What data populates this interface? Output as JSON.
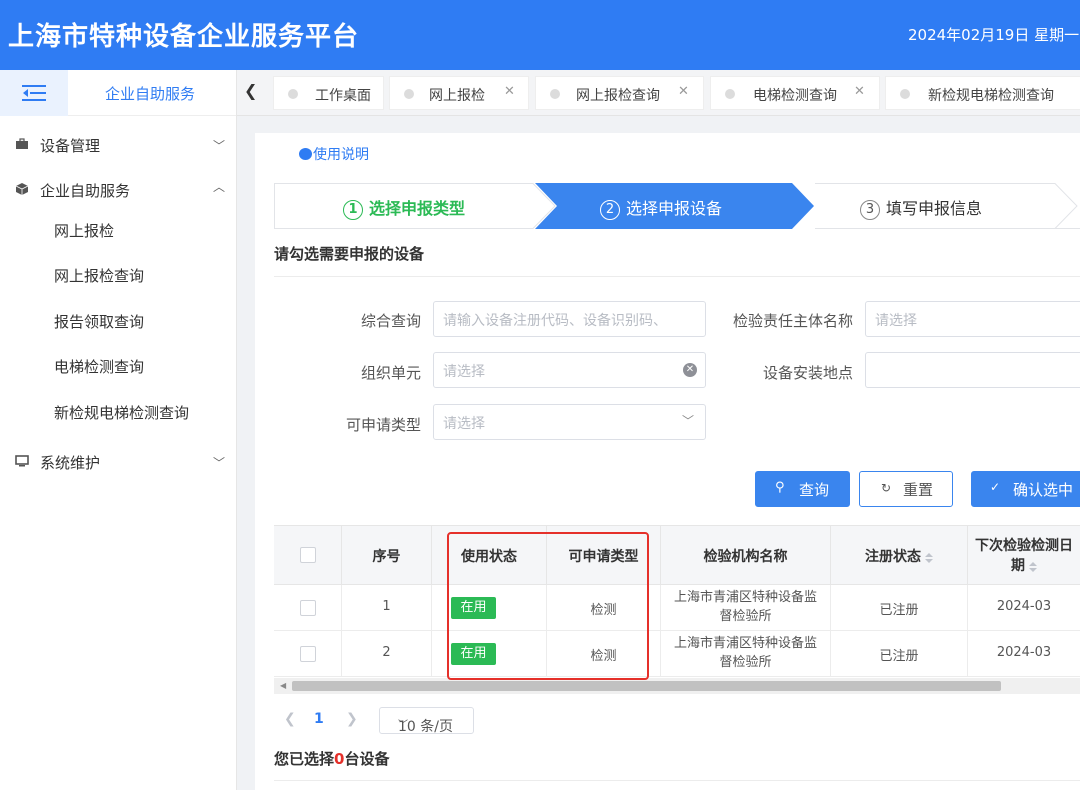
{
  "header": {
    "title": "上海市特种设备企业服务平台",
    "date": "2024年02月19日 星期一"
  },
  "sidebar": {
    "top_label": "企业自助服务",
    "groups": [
      {
        "label": "设备管理",
        "icon": "briefcase-icon",
        "expanded": false
      },
      {
        "label": "企业自助服务",
        "icon": "cube-icon",
        "expanded": true,
        "items": [
          "网上报检",
          "网上报检查询",
          "报告领取查询",
          "电梯检测查询",
          "新检规电梯检测查询"
        ]
      },
      {
        "label": "系统维护",
        "icon": "monitor-icon",
        "expanded": false
      }
    ]
  },
  "tabs": [
    {
      "label": "工作桌面",
      "closable": false
    },
    {
      "label": "网上报检",
      "closable": true
    },
    {
      "label": "网上报检查询",
      "closable": true
    },
    {
      "label": "电梯检测查询",
      "closable": true
    },
    {
      "label": "新检规电梯检测查询",
      "closable": true
    }
  ],
  "main": {
    "help_link": "使用说明",
    "steps": [
      {
        "num": "1",
        "label": "选择申报类型",
        "state": "done"
      },
      {
        "num": "2",
        "label": "选择申报设备",
        "state": "active"
      },
      {
        "num": "3",
        "label": "填写申报信息",
        "state": "pending"
      }
    ],
    "section_title": "请勾选需要申报的设备",
    "form": {
      "query_label": "综合查询",
      "query_placeholder": "请输入设备注册代码、设备识别码、",
      "entity_label": "检验责任主体名称",
      "entity_placeholder": "请选择",
      "org_label": "组织单元",
      "org_placeholder": "请选择",
      "location_label": "设备安装地点",
      "location_placeholder": "",
      "type_label": "可申请类型",
      "type_placeholder": "请选择"
    },
    "buttons": {
      "search": "查询",
      "reset": "重置",
      "confirm": "确认选中"
    },
    "table": {
      "columns": [
        "",
        "序号",
        "使用状态",
        "可申请类型",
        "检验机构名称",
        "注册状态",
        "下次检验检测日期"
      ],
      "rows": [
        {
          "index": "1",
          "status": "在用",
          "type": "检测",
          "agency_line1": "上海市青浦区特种设备监",
          "agency_line2": "督检验所",
          "reg": "已注册",
          "next_date": "2024-03"
        },
        {
          "index": "2",
          "status": "在用",
          "type": "检测",
          "agency_line1": "上海市青浦区特种设备监",
          "agency_line2": "督检验所",
          "reg": "已注册",
          "next_date": "2024-03"
        }
      ]
    },
    "pagination": {
      "current": "1",
      "page_size": "10 条/页"
    },
    "selected": {
      "prefix": "您已选择",
      "count": "0",
      "suffix": "台设备"
    }
  },
  "colors": {
    "brand": "#2f7cf3",
    "success_badge": "#2bba55",
    "highlight_box": "#e5302a",
    "step_done": "#2bba55"
  }
}
